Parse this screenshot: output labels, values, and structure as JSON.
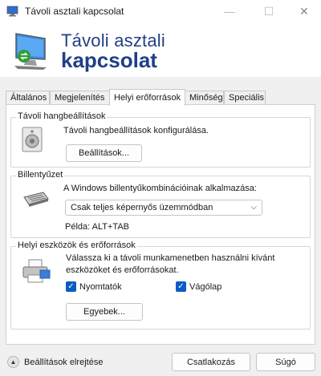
{
  "window": {
    "title": "Távoli asztali kapcsolat",
    "minimize": "—",
    "maximize": "☐",
    "close": "✕"
  },
  "banner": {
    "line1": "Távoli asztali",
    "line2": "kapcsolat"
  },
  "tabs": [
    {
      "label": "Általános",
      "active": false
    },
    {
      "label": "Megjelenítés",
      "active": false
    },
    {
      "label": "Helyi erőforrások",
      "active": true
    },
    {
      "label": "Minőség",
      "active": false
    },
    {
      "label": "Speciális",
      "active": false
    }
  ],
  "audio": {
    "title": "Távoli hangbeállítások",
    "description": "Távoli hangbeállítások konfigurálása.",
    "button": "Beállítások..."
  },
  "keyboard": {
    "title": "Billentyűzet",
    "description": "A Windows billentyűkombinációinak alkalmazása:",
    "selected": "Csak teljes képernyős üzemmódban",
    "example": "Példa: ALT+TAB"
  },
  "devices": {
    "title": "Helyi eszközök és erőforrások",
    "description_line1": "Válassza ki a távoli munkamenetben használni kívánt",
    "description_line2": "eszközöket és erőforrásokat.",
    "printers_label": "Nyomtatók",
    "printers_checked": true,
    "clipboard_label": "Vágólap",
    "clipboard_checked": true,
    "more_button": "Egyebek..."
  },
  "footer": {
    "hide_options": "Beállítások elrejtése",
    "connect": "Csatlakozás",
    "help": "Súgó"
  },
  "colors": {
    "brand_blue": "#1f3f87",
    "checkbox_blue": "#0a5cc5"
  }
}
